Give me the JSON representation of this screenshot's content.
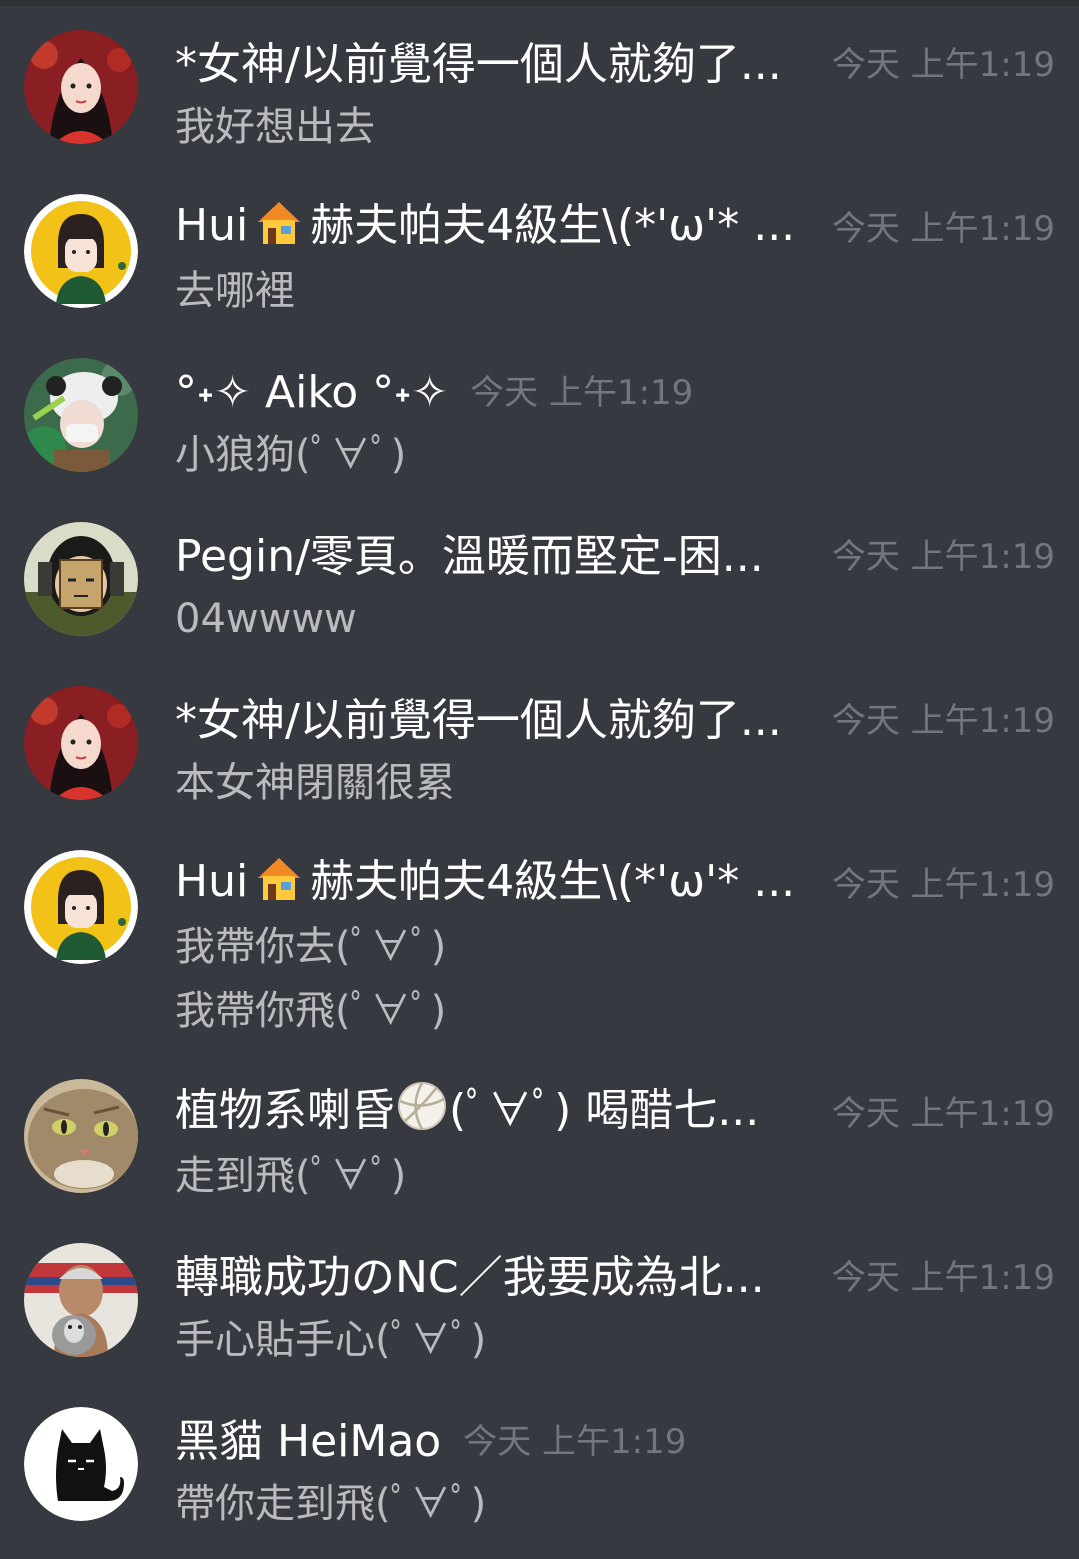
{
  "messages": [
    {
      "author": "*女神/以前覺得一個人就夠了...",
      "time": "今天 上午1:19",
      "lines": [
        "我好想出去"
      ]
    },
    {
      "author_prefix": "Hui",
      "author_suffix": "赫夫帕夫4級生\\(*'ω'* ...",
      "time": "今天 上午1:19",
      "lines": [
        "去哪裡"
      ]
    },
    {
      "author": "°˖✧ Aiko °˖✧",
      "time": "今天 上午1:19",
      "lines": [
        "小狼狗(ﾟ∀ﾟ)"
      ]
    },
    {
      "author": "Pegin/零頁。溫暖而堅定-困...",
      "time": "今天 上午1:19",
      "lines": [
        "04wwww"
      ]
    },
    {
      "author": "*女神/以前覺得一個人就夠了...",
      "time": "今天 上午1:19",
      "lines": [
        "本女神閉關很累"
      ]
    },
    {
      "author_prefix": "Hui",
      "author_suffix": "赫夫帕夫4級生\\(*'ω'* ...",
      "time": "今天 上午1:19",
      "lines": [
        "我帶你去(ﾟ∀ﾟ)",
        "我帶你飛(ﾟ∀ﾟ)"
      ]
    },
    {
      "author_prefix": "植物系喇昏",
      "author_suffix": "(ﾟ∀ﾟ) 喝醋七...",
      "time": "今天 上午1:19",
      "lines": [
        "走到飛(ﾟ∀ﾟ)"
      ]
    },
    {
      "author": "轉職成功のNC／我要成為北...",
      "time": "今天 上午1:19",
      "lines": [
        "手心貼手心(ﾟ∀ﾟ)"
      ]
    },
    {
      "author": "黑貓 HeiMao",
      "time": "今天 上午1:19",
      "lines": [
        "帶你走到飛(ﾟ∀ﾟ)"
      ]
    }
  ],
  "colors": {
    "background": "#36393f",
    "author": "#ffffff",
    "timestamp": "#72767d",
    "message": "#b9bbbe"
  },
  "icons": [
    "house-emoji-icon",
    "volleyball-emoji-icon"
  ]
}
